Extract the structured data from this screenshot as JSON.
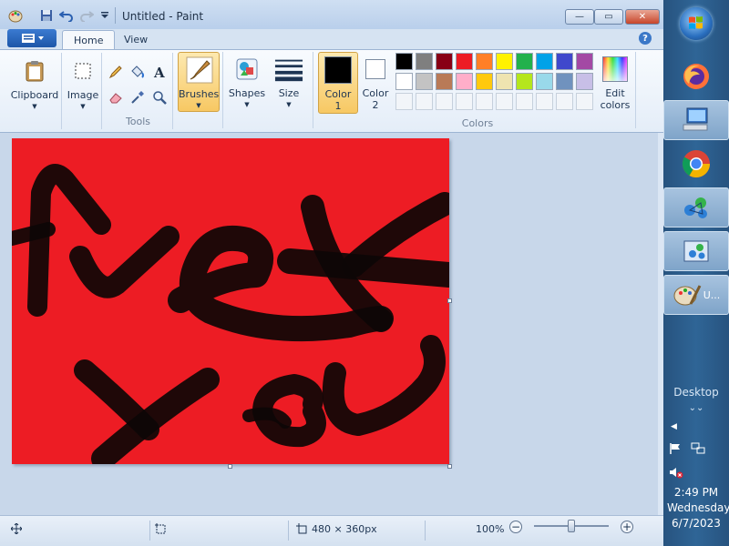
{
  "window": {
    "title": "Untitled - Paint",
    "minimize": "—",
    "maximize": "▭",
    "close": "✕"
  },
  "tabs": {
    "home": "Home",
    "view": "View"
  },
  "help": "?",
  "ribbon": {
    "clipboard": "Clipboard",
    "image": "Image",
    "tools": "Tools",
    "brushes": "Brushes",
    "shapes": "Shapes",
    "size": "Size",
    "color1": "Color",
    "color1_num": "1",
    "color2": "Color",
    "color2_num": "2",
    "colors": "Colors",
    "edit_colors": "Edit",
    "edit_colors2": "colors",
    "palette_row1": [
      "#000000",
      "#7f7f7f",
      "#880015",
      "#ed1c24",
      "#ff7f27",
      "#fff200",
      "#22b14c",
      "#00a2e8",
      "#3f48cc",
      "#a349a4"
    ],
    "palette_row2": [
      "#ffffff",
      "#c3c3c3",
      "#b97a57",
      "#ffaec9",
      "#ffc90e",
      "#efe4b0",
      "#b5e61d",
      "#99d9ea",
      "#7092be",
      "#c8bfe7"
    ],
    "color1_value": "#000000",
    "color2_value": "#ffffff",
    "canvas_color": "#ed1c24"
  },
  "status": {
    "size": "480 × 360px",
    "zoom": "100%",
    "zoom_fraction": 0.5
  },
  "taskbar": {
    "active_app_label": "U...",
    "desktop": "Desktop",
    "time": "2:49 PM",
    "day": "Wednesday",
    "date": "6/7/2023"
  }
}
